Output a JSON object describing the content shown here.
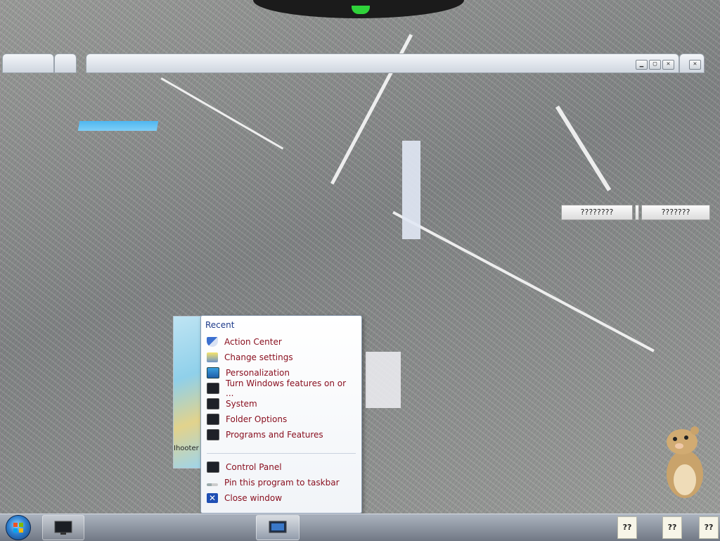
{
  "window_controls": {
    "minimize": "▁",
    "maximize": "▢",
    "close": "✕"
  },
  "side_buttons": [
    "????????",
    "???????"
  ],
  "preview": {
    "text": "Ihooter"
  },
  "jump_list": {
    "header": "Recent",
    "recent_items": [
      {
        "label": "Action Center",
        "icon": "shield-icon"
      },
      {
        "label": "Change settings",
        "icon": "settings-icon"
      },
      {
        "label": "Personalization",
        "icon": "personalization-icon"
      },
      {
        "label": "Turn Windows features on or ...",
        "icon": "monitor-icon"
      },
      {
        "label": "System",
        "icon": "monitor-icon"
      },
      {
        "label": "Folder Options",
        "icon": "monitor-icon"
      },
      {
        "label": "Programs and Features",
        "icon": "monitor-icon"
      }
    ],
    "task_items": [
      {
        "label": "Control Panel",
        "icon": "monitor-icon"
      },
      {
        "label": "Pin this program to taskbar",
        "icon": "pin-icon"
      },
      {
        "label": "Close window",
        "icon": "close-icon"
      }
    ]
  },
  "tray": {
    "icons": [
      "??",
      "??",
      "??"
    ]
  },
  "colors": {
    "link_text": "#8a1020",
    "header_text": "#1d3a8a",
    "accent": "#2e7fcf"
  }
}
